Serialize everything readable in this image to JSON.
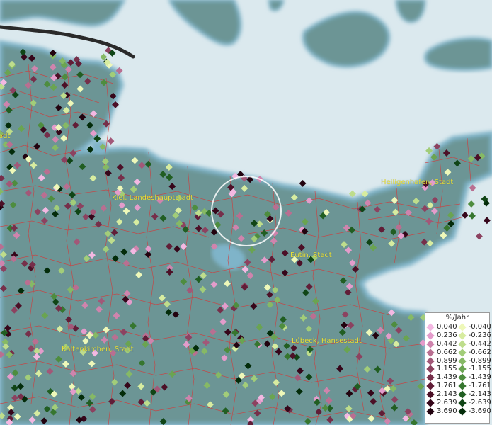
{
  "map": {
    "colors": {
      "water": "#dbe9ee",
      "land": "#6c9595",
      "shore": "#7fb4c9",
      "boundary": "#d23a3a",
      "road": "#2a2a2a",
      "label": "#e8e03a"
    },
    "place_labels": [
      {
        "id": "kiel",
        "text": "Kiel, Landeshauptstadt"
      },
      {
        "id": "eutin",
        "text": "Eutin, Stadt"
      },
      {
        "id": "heiligenhafen",
        "text": "Heiligenhafen, Stadt"
      },
      {
        "id": "luebeck",
        "text": "Lübeck, Hansestadt"
      },
      {
        "id": "kaltenkirchen",
        "text": "Kaltenkirchen, Stadt"
      },
      {
        "id": "edge",
        "text": "adt"
      }
    ]
  },
  "legend": {
    "title": "%/Jahr",
    "positive": [
      {
        "value": "0.040",
        "color": "#f3b8e2"
      },
      {
        "value": "0.236",
        "color": "#e49ccb"
      },
      {
        "value": "0.442",
        "color": "#cf84ad"
      },
      {
        "value": "0.662",
        "color": "#b96f91"
      },
      {
        "value": "0.899",
        "color": "#a25878"
      },
      {
        "value": "1.155",
        "color": "#8c4260"
      },
      {
        "value": "1.439",
        "color": "#762f4a"
      },
      {
        "value": "1.761",
        "color": "#611d37"
      },
      {
        "value": "2.143",
        "color": "#4c1027"
      },
      {
        "value": "2.639",
        "color": "#36061a"
      },
      {
        "value": "3.690",
        "color": "#22030f"
      }
    ],
    "negative": [
      {
        "value": "-0.040",
        "color": "#eef8b9"
      },
      {
        "value": "-0.236",
        "color": "#d7eca0"
      },
      {
        "value": "-0.442",
        "color": "#bedd8c"
      },
      {
        "value": "-0.662",
        "color": "#a2cd79"
      },
      {
        "value": "-0.899",
        "color": "#86b965"
      },
      {
        "value": "-1.155",
        "color": "#6aa451"
      },
      {
        "value": "-1.439",
        "color": "#4e8d3f"
      },
      {
        "value": "-1.761",
        "color": "#36762f"
      },
      {
        "value": "-2.143",
        "color": "#215e22"
      },
      {
        "value": "-2.639",
        "color": "#104516"
      },
      {
        "value": "-3.690",
        "color": "#032c0a"
      }
    ]
  }
}
